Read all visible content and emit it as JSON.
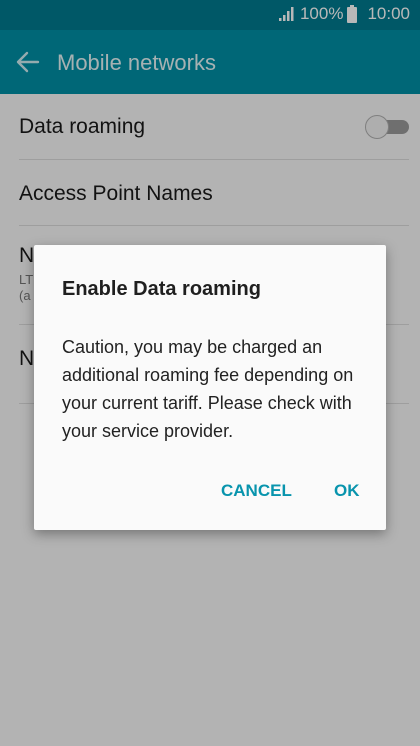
{
  "status_bar": {
    "battery_percent": "100%",
    "time": "10:00",
    "icons": [
      "signal-icon",
      "battery-icon"
    ]
  },
  "app_bar": {
    "title": "Mobile networks",
    "back_icon": "back-arrow-icon"
  },
  "settings": {
    "data_roaming": {
      "label": "Data roaming",
      "enabled": false
    },
    "access_point_names": {
      "label": "Access Point Names"
    },
    "network_mode": {
      "label_partial": "N",
      "sub_line1": "LT",
      "sub_line2": "(a"
    },
    "network_operators": {
      "label_partial": "N"
    }
  },
  "dialog": {
    "title": "Enable Data roaming",
    "message": "Caution, you may be charged an additional roaming fee depending on your current tariff. Please check with your service provider.",
    "cancel_label": "CANCEL",
    "ok_label": "OK"
  },
  "colors": {
    "status_bar": "#007b8f",
    "app_bar": "#008fa6",
    "accent": "#0894ad"
  }
}
